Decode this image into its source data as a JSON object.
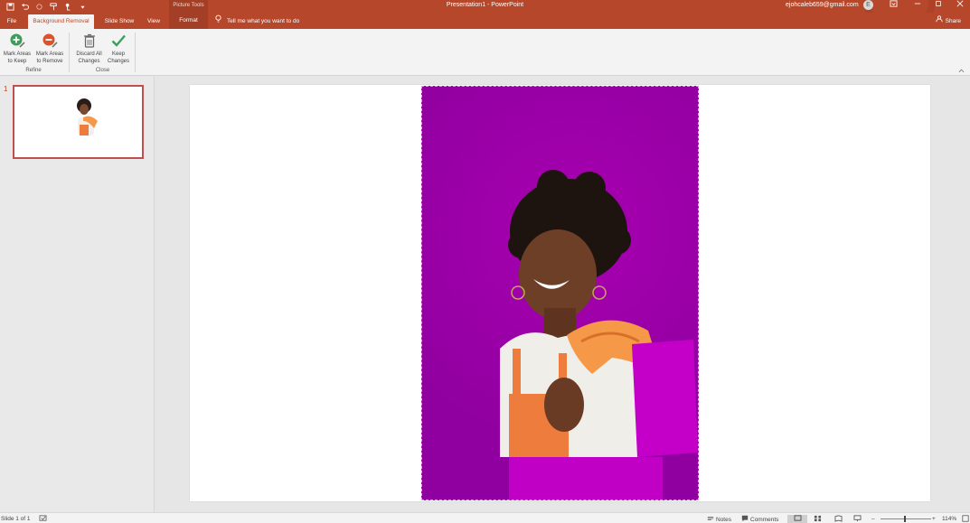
{
  "titlebar": {
    "title": "Presentation1 - PowerPoint",
    "context_label": "Picture Tools",
    "account_email": "ejohcaleb659@gmail.com",
    "avatar_initial": "E",
    "qat_icons": [
      "save-icon",
      "undo-icon",
      "redo-icon",
      "format-painter-icon",
      "touch-mode-icon",
      "customize-qat-icon"
    ]
  },
  "tabs": {
    "file": "File",
    "background_removal": "Background Removal",
    "slide_show": "Slide Show",
    "view": "View",
    "format": "Format",
    "tell_me": "Tell me what you want to do",
    "share": "Share"
  },
  "ribbon": {
    "mark_keep": "Mark Areas to Keep",
    "mark_keep_l1": "Mark Areas",
    "mark_keep_l2": "to Keep",
    "mark_remove_l1": "Mark Areas",
    "mark_remove_l2": "to Remove",
    "discard_l1": "Discard All",
    "discard_l2": "Changes",
    "keep_l1": "Keep",
    "keep_l2": "Changes",
    "group_refine": "Refine",
    "group_close": "Close"
  },
  "thumbnails": [
    {
      "number": "1"
    }
  ],
  "status": {
    "slide_info": "Slide 1 of 1",
    "notes": "Notes",
    "comments": "Comments",
    "zoom": "114%",
    "zoom_fraction": 0.5
  },
  "colors": {
    "brand": "#b7472a",
    "removal_overlay": "#a000a6"
  }
}
